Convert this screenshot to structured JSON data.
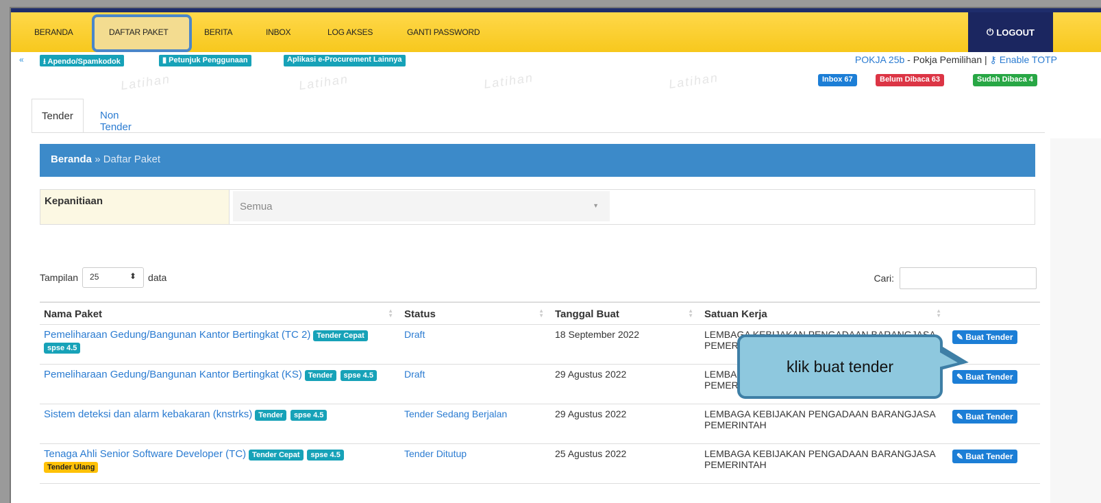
{
  "nav": {
    "items": [
      "BERANDA",
      "DAFTAR PAKET",
      "BERITA",
      "INBOX",
      "LOG AKSES",
      "GANTI PASSWORD"
    ],
    "logout": "LOGOUT"
  },
  "subbar": {
    "apendo": "Apendo/Spamkodok",
    "petunjuk": "Petunjuk Penggunaan",
    "aplikasi": "Aplikasi e-Procurement Lainnya",
    "user_role": "POKJA 25b",
    "user_desc": " - Pokja Pemilihan | ",
    "totp": "Enable TOTP"
  },
  "badges": {
    "inbox": "Inbox 67",
    "unread": "Belum Dibaca 63",
    "read": "Sudah Dibaca 4"
  },
  "watermark": "Latihan",
  "tabs": [
    "Tender",
    "Non Tender"
  ],
  "breadcrumb": {
    "home": "Beranda",
    "sep": " » ",
    "current": "Daftar Paket"
  },
  "filter": {
    "label": "Kepanitiaan",
    "value": "Semua"
  },
  "table_controls": {
    "show_label": "Tampilan",
    "show_value": "25",
    "show_suffix": "data",
    "search_label": "Cari:"
  },
  "table": {
    "headers": [
      "Nama Paket",
      "Status",
      "Tanggal Buat",
      "Satuan Kerja",
      ""
    ],
    "rows": [
      {
        "name": "Pemeliharaan Gedung/Bangunan Kantor Bertingkat (TC 2)",
        "tags": [
          "Tender Cepat",
          "spse 4.5"
        ],
        "status": "Draft",
        "date": "18 September 2022",
        "satker": "LEMBAGA KEBIJAKAN PENGADAAN BARANGJASA PEMERINTAH",
        "action": "Buat Tender"
      },
      {
        "name": "Pemeliharaan Gedung/Bangunan Kantor Bertingkat (KS)",
        "tags": [
          "Tender",
          "spse 4.5"
        ],
        "status": "Draft",
        "date": "29 Agustus 2022",
        "satker": "LEMBAGA KEBIJAKAN PENGADAAN BARANGJASA PEMERINTAH",
        "action": "Buat Tender"
      },
      {
        "name": "Sistem deteksi dan alarm kebakaran (knstrks)",
        "tags": [
          "Tender",
          "spse 4.5"
        ],
        "status": "Tender Sedang Berjalan",
        "date": "29 Agustus 2022",
        "satker": "LEMBAGA KEBIJAKAN PENGADAAN BARANGJASA PEMERINTAH",
        "action": "Buat Tender"
      },
      {
        "name": "Tenaga Ahli Senior Software Developer (TC)",
        "tags": [
          "Tender Cepat",
          "spse 4.5",
          "Tender Ulang"
        ],
        "status": "Tender Ditutup",
        "date": "25 Agustus 2022",
        "satker": "LEMBAGA KEBIJAKAN PENGADAAN BARANGJASA PEMERINTAH",
        "action": "Buat Tender"
      }
    ]
  },
  "callout": "klik buat tender",
  "colors": {
    "navbar": "#f7c81d",
    "logout_bg": "#1b2660",
    "breadcrumb": "#3c8ac9",
    "link": "#2a7bd1",
    "info_tag": "#17a2b8",
    "warn_tag": "#ffc107",
    "action_button": "#1c7ed6"
  },
  "icons": [
    "chevron-up-icon",
    "download-icon",
    "book-icon",
    "key-icon",
    "power-icon",
    "edit-icon",
    "sort-icon"
  ]
}
